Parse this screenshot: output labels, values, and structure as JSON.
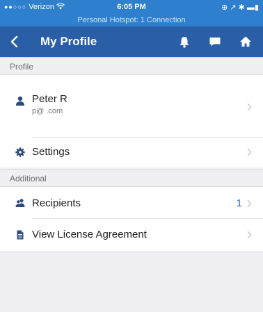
{
  "status_bar": {
    "signal": "●●○○○",
    "carrier": "Verizon",
    "wifi": "wifi-icon",
    "time": "6:05 PM",
    "right_icons": "⊕ ↗ ✱ ▬▮"
  },
  "hotspot_banner": "Personal Hotspot: 1 Connection",
  "nav": {
    "title": "My Profile",
    "icons": [
      "back-chevron-icon",
      "bell-icon",
      "chat-icon",
      "home-icon"
    ]
  },
  "sections": {
    "profile": "Profile",
    "additional": "Additional"
  },
  "profile": {
    "name": "Peter R",
    "email": "p@ .com"
  },
  "rows": {
    "settings": "Settings",
    "recipients": "Recipients",
    "recipients_count": "1",
    "license": "View License Agreement"
  },
  "colors": {
    "status_bar": "#2e7fce",
    "nav_bar": "#2a5fa8",
    "row_icon": "#2c4a7a",
    "accent": "#2a6ec0"
  }
}
